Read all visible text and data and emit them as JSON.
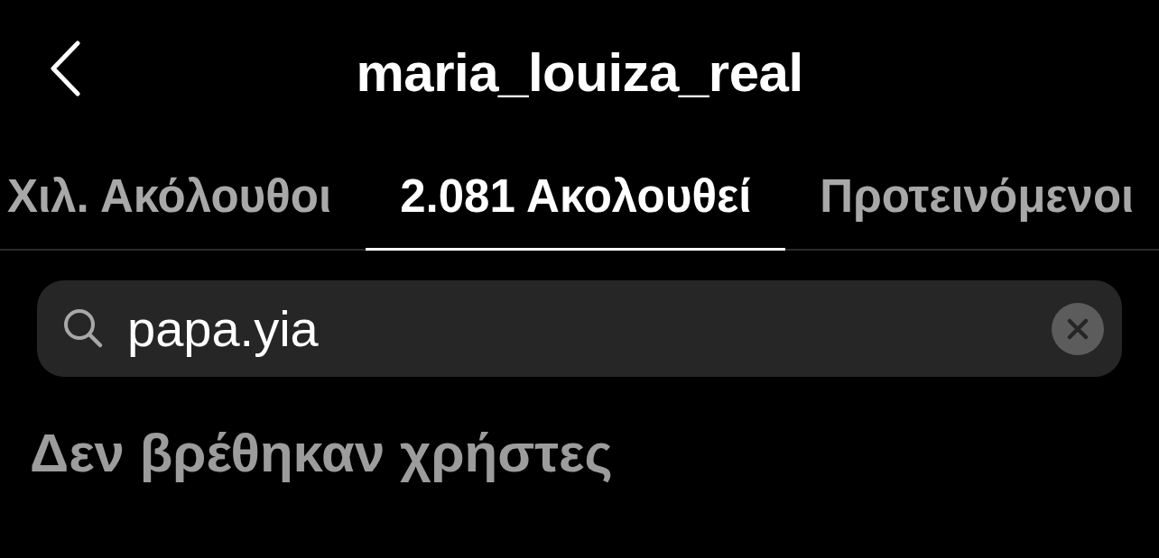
{
  "header": {
    "title": "maria_louiza_real"
  },
  "tabs": [
    {
      "label": "Χιλ. Ακόλουθοι",
      "selected": false
    },
    {
      "label": "2.081 Ακολουθεί",
      "selected": true
    },
    {
      "label": "Προτεινόμενοι",
      "selected": false
    }
  ],
  "search": {
    "value": "papa.yia"
  },
  "empty_message": "Δεν βρέθηκαν χρήστες"
}
